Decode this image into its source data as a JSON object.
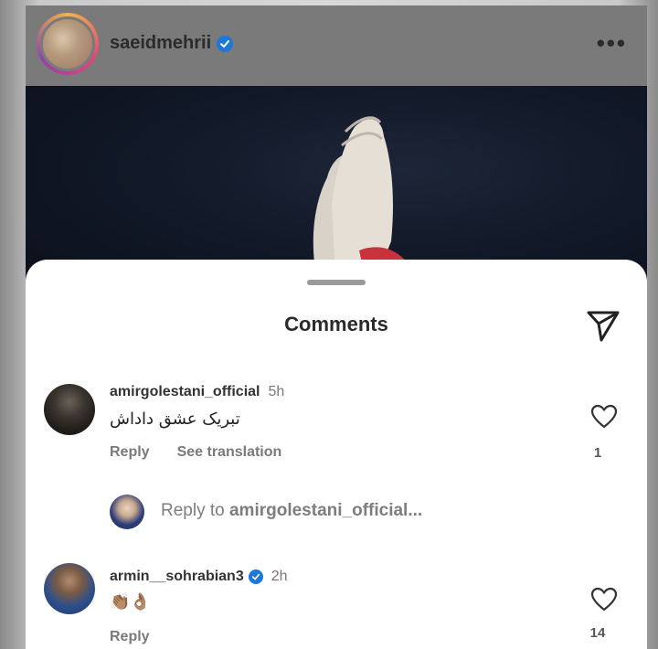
{
  "post": {
    "username": "saeidmehrii",
    "more_label": "•••"
  },
  "comments_sheet": {
    "title": "Comments",
    "comments": [
      {
        "username": "amirgolestani_official",
        "time": "5h",
        "text": "تبریک عشق داداش",
        "reply_label": "Reply",
        "translate_label": "See translation",
        "likes": "1"
      },
      {
        "username": "armin__sohrabian3",
        "time": "2h",
        "text": "👏🏽👌🏽",
        "reply_label": "Reply",
        "likes": "14"
      }
    ],
    "reply_prompt": {
      "prefix": "Reply to ",
      "target": "amirgolestani_official..."
    }
  },
  "colors": {
    "verified": "#1e78d8",
    "sheet_background": "#ffffff"
  }
}
